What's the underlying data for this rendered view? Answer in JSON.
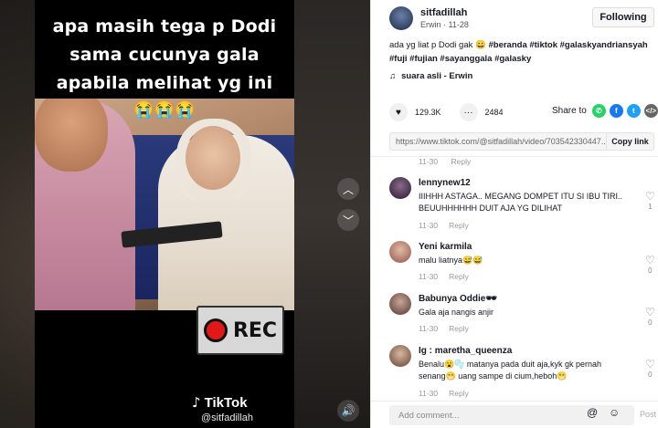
{
  "video": {
    "caption_lines": [
      "apa masih tega p Dodi",
      "sama cucunya gala",
      "apabila melihat yg ini"
    ],
    "caption_emojis": "😭😭😭",
    "rec_label": "REC",
    "watermark_logo": "TikTok",
    "watermark_user": "@sitfadillah",
    "nav_up_icon": "chevron-up-icon",
    "nav_down_icon": "chevron-down-icon",
    "volume_icon": "volume-icon"
  },
  "author": {
    "username": "sitfadillah",
    "nickname": "Erwin",
    "date": "11-28",
    "follow_label": "Following"
  },
  "description": {
    "text": "ada yg liat p Dodi gak 😀",
    "hashtags": "#beranda #tiktok #galaskyandriansyah #fuji #fujian #sayanggala #galasky",
    "music": "suara asli - Erwin"
  },
  "stats": {
    "likes": "129.3K",
    "comments": "2484",
    "share_label": "Share to",
    "share_icons": [
      "whatsapp-icon",
      "facebook-icon",
      "twitter-icon",
      "embed-icon"
    ]
  },
  "link": {
    "url": "https://www.tiktok.com/@sitfadillah/video/703542330447...",
    "copy_label": "Copy link"
  },
  "partial_comment": {
    "date": "11-30",
    "reply_label": "Reply"
  },
  "comments": [
    {
      "user": "lennynew12",
      "text": "IIIHHH ASTAGA.. MEGANG DOMPET ITU SI IBU TIRI.. BEUUHHHHHH DUIT AJA YG DILIHAT",
      "date": "11-30",
      "reply_label": "Reply",
      "likes": "1"
    },
    {
      "user": "Yeni karmila",
      "text": "malu liatnya😅😅",
      "date": "11-30",
      "reply_label": "Reply",
      "likes": "0"
    },
    {
      "user": "Babunya Oddie🕶",
      "text": "Gala aja nangis anjir",
      "date": "11-30",
      "reply_label": "Reply",
      "likes": "0"
    },
    {
      "user": "Ig : maretha_queenza",
      "text": "Benalu😮🫧 matanya pada duit aja,kyk gk pernah senang😁 uang sampe di cium,heboh😁",
      "date": "11-30",
      "reply_label": "Reply",
      "likes": "0"
    }
  ],
  "add_comment": {
    "placeholder": "Add comment...",
    "post_label": "Post"
  },
  "colors": {
    "whatsapp": "#25d366",
    "facebook": "#1877f2",
    "twitter": "#1da1f2",
    "embed": "#666666",
    "rec_dot": "#e01818"
  }
}
